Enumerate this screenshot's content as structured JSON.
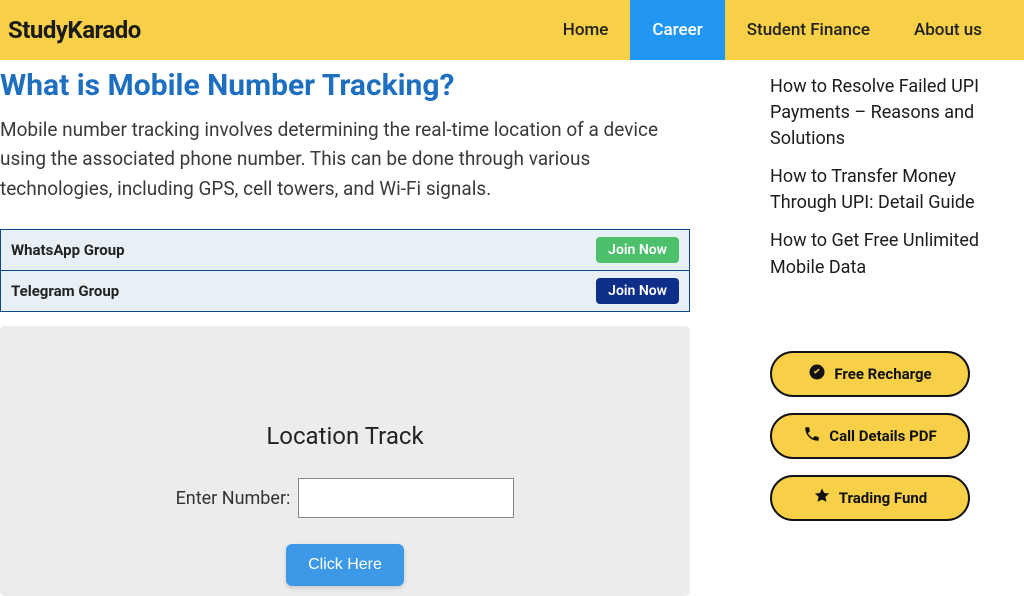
{
  "brand": "StudyKarado",
  "nav": {
    "items": [
      "Home",
      "Career",
      "Student Finance",
      "About us"
    ],
    "active_index": 1
  },
  "main": {
    "heading": "What is Mobile Number Tracking?",
    "paragraph": "Mobile number tracking involves determining the real-time location of a device using the associated phone number. This can be done through various technologies, including GPS, cell towers, and Wi-Fi signals.",
    "groups": [
      {
        "name": "WhatsApp Group",
        "cta": "Join Now",
        "style": "green"
      },
      {
        "name": "Telegram Group",
        "cta": "Join Now",
        "style": "blue"
      }
    ],
    "tracker": {
      "title": "Location Track",
      "label": "Enter Number:",
      "button": "Click Here"
    }
  },
  "sidebar": {
    "posts": [
      "How to Resolve Failed UPI Payments – Reasons and Solutions",
      "How to Transfer Money Through UPI: Detail Guide",
      "How to Get Free Unlimited Mobile Data"
    ],
    "pills": [
      {
        "icon": "check-circle-icon",
        "label": "Free Recharge"
      },
      {
        "icon": "phone-icon",
        "label": "Call Details PDF"
      },
      {
        "icon": "star-icon",
        "label": "Trading Fund"
      }
    ]
  }
}
